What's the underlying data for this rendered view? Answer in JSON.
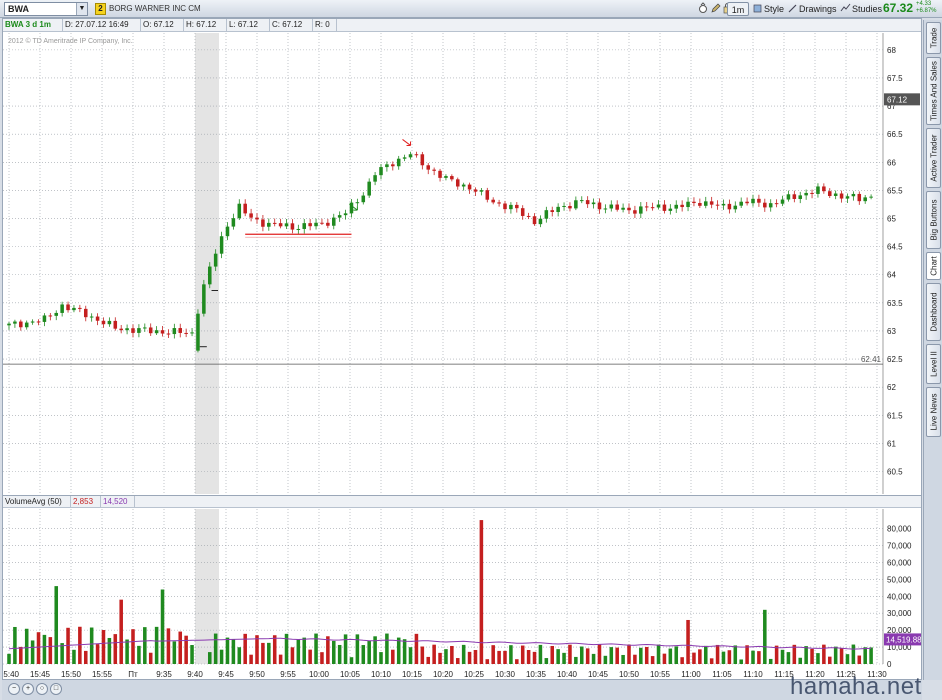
{
  "toolbar": {
    "symbol": "BWA",
    "link_group": "2",
    "company": "BORG WARNER INC CM",
    "interval_button": "1m",
    "style_label": "Style",
    "drawings_label": "Drawings",
    "studies_label": "Studies",
    "last_price": "67.32",
    "change_abs": "+4.33",
    "change_pct": "+6.87%"
  },
  "header": {
    "symbol_label": "BWA 3 d 1m",
    "date": "D: 27.07.12 16:49",
    "open": "O: 67.12",
    "high": "H: 67.12",
    "low": "L: 67.12",
    "close": "C: 67.12",
    "range": "R: 0"
  },
  "copyright": "2012 © TD Ameritrade IP Company, Inc.",
  "volume_header": {
    "study": "VolumeAvg (50)",
    "value_red": "2,853",
    "value_purple": "14,520"
  },
  "side_tabs": [
    "Trade",
    "Times And Sales",
    "Active Trader",
    "Big Buttons",
    "Chart",
    "Dashboard",
    "Level II",
    "Live News"
  ],
  "active_tab": "Chart",
  "colors": {
    "up": "#1f8a1f",
    "down": "#c41f1f",
    "avg": "#8a3ab0",
    "annotation": "#e02020",
    "grid": "#9aa0a8"
  },
  "watermark": "hamaha.net",
  "chart_data": [
    {
      "type": "candlestick",
      "price_ticks": [
        "68",
        "67.5",
        "67",
        "66.5",
        "66",
        "65.5",
        "65",
        "64.5",
        "64",
        "63.5",
        "63",
        "62.5",
        "62",
        "61.5",
        "61",
        "60.5"
      ],
      "ylim": [
        60.1,
        68.3
      ],
      "x_ticks": [
        "15:40",
        "15:45",
        "15:50",
        "15:55",
        "Пт",
        "9:35",
        "9:40",
        "9:45",
        "9:50",
        "9:55",
        "10:00",
        "10:05",
        "10:10",
        "10:15",
        "10:20",
        "10:25",
        "10:30",
        "10:35",
        "10:40",
        "10:45",
        "10:50",
        "10:55",
        "11:00",
        "11:05",
        "11:10",
        "11:15",
        "11:20",
        "11:25",
        "11:30"
      ],
      "current_price_label": "67.12",
      "reference_price_label": "62.41",
      "reference_price": 62.41,
      "price_path": [
        [
          0,
          63.1
        ],
        [
          6,
          63.2
        ],
        [
          9,
          63.45
        ],
        [
          13,
          63.3
        ],
        [
          18,
          63.05
        ],
        [
          24,
          63.0
        ],
        [
          31,
          62.96
        ],
        [
          33,
          63.8
        ],
        [
          35,
          64.4
        ],
        [
          37,
          64.9
        ],
        [
          39,
          65.2
        ],
        [
          41,
          65.0
        ],
        [
          44,
          64.9
        ],
        [
          48,
          64.85
        ],
        [
          53,
          64.9
        ],
        [
          57,
          65.1
        ],
        [
          60,
          65.45
        ],
        [
          62,
          65.8
        ],
        [
          65,
          66.0
        ],
        [
          68,
          66.15
        ],
        [
          71,
          65.9
        ],
        [
          74,
          65.7
        ],
        [
          78,
          65.55
        ],
        [
          82,
          65.3
        ],
        [
          86,
          65.15
        ],
        [
          89,
          64.95
        ],
        [
          93,
          65.2
        ],
        [
          97,
          65.3
        ],
        [
          101,
          65.2
        ],
        [
          105,
          65.15
        ],
        [
          109,
          65.2
        ],
        [
          113,
          65.2
        ],
        [
          117,
          65.3
        ],
        [
          121,
          65.2
        ],
        [
          125,
          65.3
        ],
        [
          129,
          65.25
        ],
        [
          133,
          65.4
        ],
        [
          137,
          65.5
        ],
        [
          141,
          65.4
        ],
        [
          144,
          65.35
        ],
        [
          146,
          65.4
        ]
      ],
      "annotations": [
        {
          "type": "horizontal-line",
          "price": 64.72,
          "from_bar": 40,
          "to_bar": 58
        },
        {
          "type": "arrow",
          "bar": 68,
          "price": 66.3,
          "direction": "down",
          "color": "#e02020"
        },
        {
          "type": "arrow",
          "bar": 59,
          "price": 65.15,
          "direction": "down",
          "color": "#1f8a1f"
        }
      ]
    },
    {
      "type": "bar",
      "name": "VolumeAvg (50)",
      "volume_ticks": [
        "80,000",
        "70,000",
        "60,000",
        "50,000",
        "40,000",
        "30,000",
        "20,000",
        "10,000",
        "0"
      ],
      "ylim": [
        0,
        88000
      ],
      "avg_label": "14,519.88",
      "avg_value": 14519.88,
      "spikes": [
        {
          "bar": 8,
          "value": 46000,
          "dir": "up"
        },
        {
          "bar": 19,
          "value": 38000,
          "dir": "down"
        },
        {
          "bar": 26,
          "value": 44000,
          "dir": "up"
        },
        {
          "bar": 80,
          "value": 85000,
          "dir": "down"
        },
        {
          "bar": 115,
          "value": 26000,
          "dir": "down"
        },
        {
          "bar": 128,
          "value": 32000,
          "dir": "up"
        }
      ]
    }
  ]
}
